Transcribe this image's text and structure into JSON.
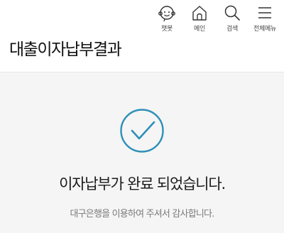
{
  "header": {
    "title": "대출이자납부결과",
    "nav": [
      {
        "label": "챗봇",
        "icon": "chatbot-icon"
      },
      {
        "label": "메인",
        "icon": "home-icon"
      },
      {
        "label": "검색",
        "icon": "search-icon"
      },
      {
        "label": "전체메뉴",
        "icon": "menu-icon"
      }
    ]
  },
  "result": {
    "icon": "check-circle-icon",
    "accent_color": "#2f8fb8",
    "message": "이자납부가 완료 되었습니다.",
    "sub_message": "대구은행을 이용하여 주셔서 감사합니다."
  }
}
